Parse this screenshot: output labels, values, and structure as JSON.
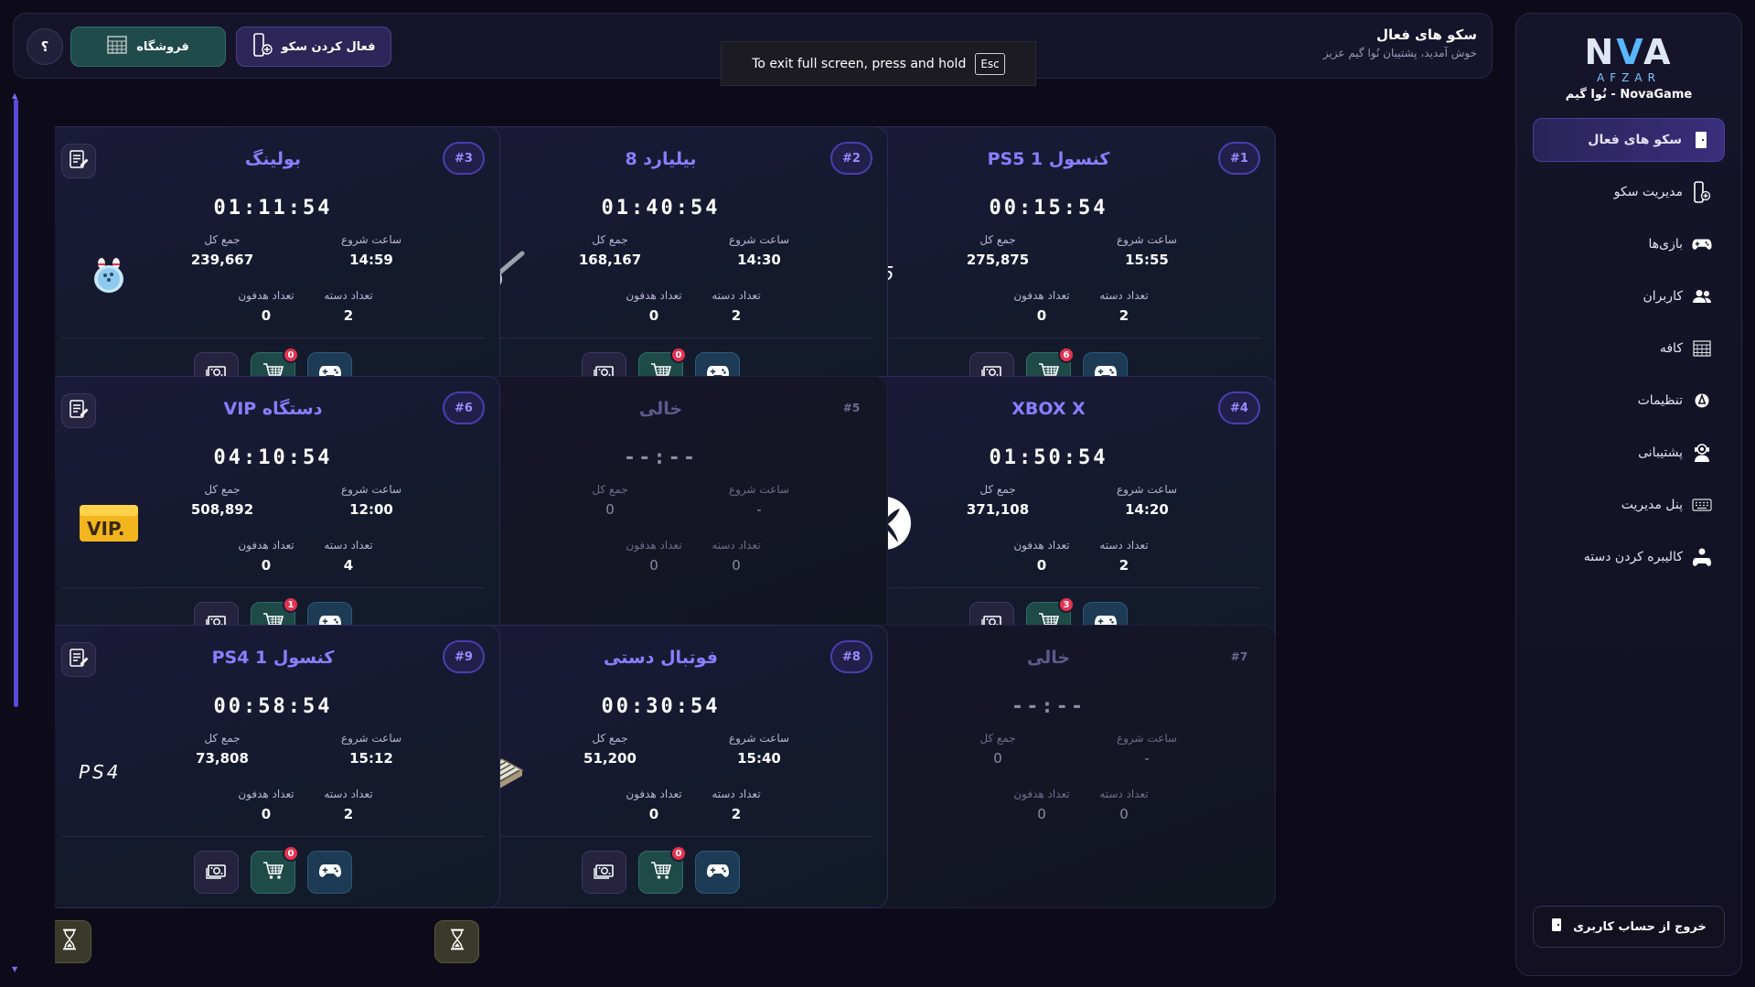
{
  "sidebar": {
    "logo": {
      "mark_a": "N",
      "mark_b": "V",
      "mark_c": "A",
      "sub": "AFZAR",
      "caption": "NovaGame - نُوا گیم"
    },
    "items": [
      {
        "label": "سکو های فعال",
        "icon": "door-icon",
        "active": true
      },
      {
        "label": "مدیریت سکو",
        "icon": "station-add-icon",
        "active": false
      },
      {
        "label": "بازی‌ها",
        "icon": "gamepad-icon",
        "active": false
      },
      {
        "label": "کاربران",
        "icon": "users-icon",
        "active": false
      },
      {
        "label": "کافه",
        "icon": "cafe-icon",
        "active": false
      },
      {
        "label": "تنظیمات",
        "icon": "settings-icon",
        "active": false
      },
      {
        "label": "پشتیبانی",
        "icon": "support-icon",
        "active": false
      },
      {
        "label": "پنل مدیریت",
        "icon": "keyboard-icon",
        "active": false
      },
      {
        "label": "کالیبره کردن دسته",
        "icon": "controller-user-icon",
        "active": false
      }
    ],
    "logout_label": "خروج از حساب کاربری"
  },
  "header": {
    "title": "سکو های فعال",
    "subtitle": "خوش آمدید، پشتیبان نُوا گیم عزیز",
    "activate_label": "فعال کردن سکو",
    "shop_label": "فروشگاه",
    "help_label": "؟"
  },
  "fullscreen_toast": {
    "text": "To exit full screen, press and hold",
    "key": "Esc"
  },
  "labels": {
    "start": "ساعت شروع",
    "total": "جمع کل",
    "controllers": "تعداد دسته",
    "headphones": "تعداد هدفون"
  },
  "stations": [
    {
      "num": "#1",
      "title": "کنسول PS5 1",
      "timer": "00:15:54",
      "start": "15:55",
      "total": "275,875",
      "controllers": "2",
      "headphones": "0",
      "cart_badge": "6",
      "device": "ps5",
      "empty": false
    },
    {
      "num": "#2",
      "title": "بیلیارد 8",
      "timer": "01:40:54",
      "start": "14:30",
      "total": "168,167",
      "controllers": "2",
      "headphones": "0",
      "cart_badge": "0",
      "device": "billiard",
      "empty": false
    },
    {
      "num": "#3",
      "title": "بولینگ",
      "timer": "01:11:54",
      "start": "14:59",
      "total": "239,667",
      "controllers": "2",
      "headphones": "0",
      "cart_badge": "0",
      "device": "bowling",
      "empty": false
    },
    {
      "num": "#4",
      "title": "XBOX X",
      "timer": "01:50:54",
      "start": "14:20",
      "total": "371,108",
      "controllers": "2",
      "headphones": "0",
      "cart_badge": "3",
      "device": "xbox",
      "empty": false
    },
    {
      "num": "#5",
      "title": "خالی",
      "timer": "--:--",
      "start": "-",
      "total": "0",
      "controllers": "0",
      "headphones": "0",
      "cart_badge": "",
      "device": "",
      "empty": true
    },
    {
      "num": "#6",
      "title": "دستگاه VIP",
      "timer": "04:10:54",
      "start": "12:00",
      "total": "508,892",
      "controllers": "4",
      "headphones": "0",
      "cart_badge": "1",
      "device": "vip",
      "empty": false
    },
    {
      "num": "#7",
      "title": "خالی",
      "timer": "--:--",
      "start": "-",
      "total": "0",
      "controllers": "0",
      "headphones": "0",
      "cart_badge": "",
      "device": "",
      "empty": true
    },
    {
      "num": "#8",
      "title": "فوتبال دستی",
      "timer": "00:30:54",
      "start": "15:40",
      "total": "51,200",
      "controllers": "2",
      "headphones": "0",
      "cart_badge": "0",
      "device": "foosball",
      "empty": false
    },
    {
      "num": "#9",
      "title": "کنسول PS4 1",
      "timer": "00:58:54",
      "start": "15:12",
      "total": "73,808",
      "controllers": "2",
      "headphones": "0",
      "cart_badge": "0",
      "device": "ps4",
      "empty": false
    }
  ]
}
